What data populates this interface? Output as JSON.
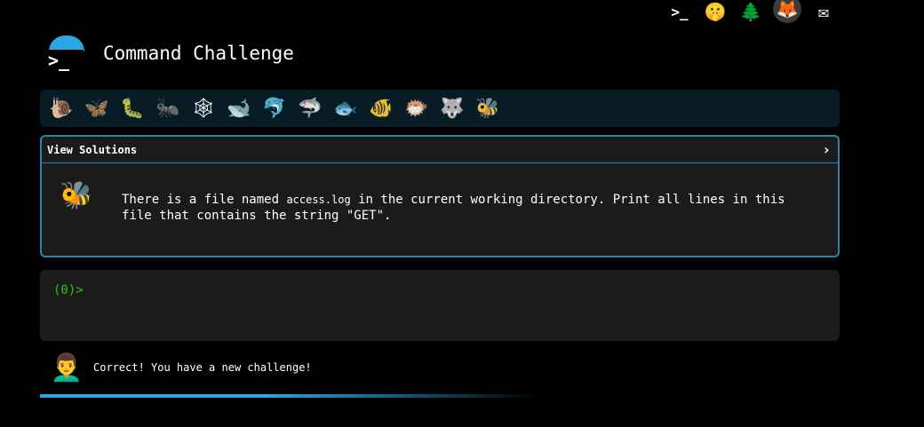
{
  "top_bar": {
    "icons": [
      {
        "name": "terminal-icon",
        "glyph": ">_"
      },
      {
        "name": "shush-face-icon",
        "glyph": "🤫"
      },
      {
        "name": "tree-icon",
        "glyph": "🌲"
      },
      {
        "name": "gitlab-icon",
        "glyph": "🦊"
      },
      {
        "name": "mail-icon",
        "glyph": "✉"
      }
    ]
  },
  "header": {
    "logo_prompt": ">_",
    "title": "Command Challenge"
  },
  "animals": [
    {
      "name": "snail-icon",
      "glyph": "🐌"
    },
    {
      "name": "butterfly-icon",
      "glyph": "🦋"
    },
    {
      "name": "caterpillar-icon",
      "glyph": "🐛"
    },
    {
      "name": "ant-icon",
      "glyph": "🐜"
    },
    {
      "name": "spider-web-icon",
      "glyph": "🕸"
    },
    {
      "name": "whale-icon",
      "glyph": "🐋"
    },
    {
      "name": "dolphin-icon",
      "glyph": "🐬"
    },
    {
      "name": "shark-icon",
      "glyph": "🦈"
    },
    {
      "name": "fish-icon",
      "glyph": "🐟"
    },
    {
      "name": "tropical-fish-icon",
      "glyph": "🐠"
    },
    {
      "name": "blowfish-icon",
      "glyph": "🐡"
    },
    {
      "name": "wolf-icon",
      "glyph": "🐺"
    },
    {
      "name": "bee-icon",
      "glyph": "🐝"
    }
  ],
  "challenge": {
    "solutions_label": "View Solutions",
    "chevron": "›",
    "icon_glyph": "🐝",
    "text_before": "There is a file named ",
    "code": "access.log",
    "text_after": " in the current working directory. Print all lines in this file that contains the string \"GET\"."
  },
  "terminal": {
    "prompt": "(0)>"
  },
  "status": {
    "avatar_glyph": "👨‍🦱",
    "message": "Correct! You have a new challenge!"
  },
  "colors": {
    "accent": "#2aa7e0",
    "panel_border": "#2a86a8",
    "prompt": "#22c522",
    "background": "#000000"
  }
}
